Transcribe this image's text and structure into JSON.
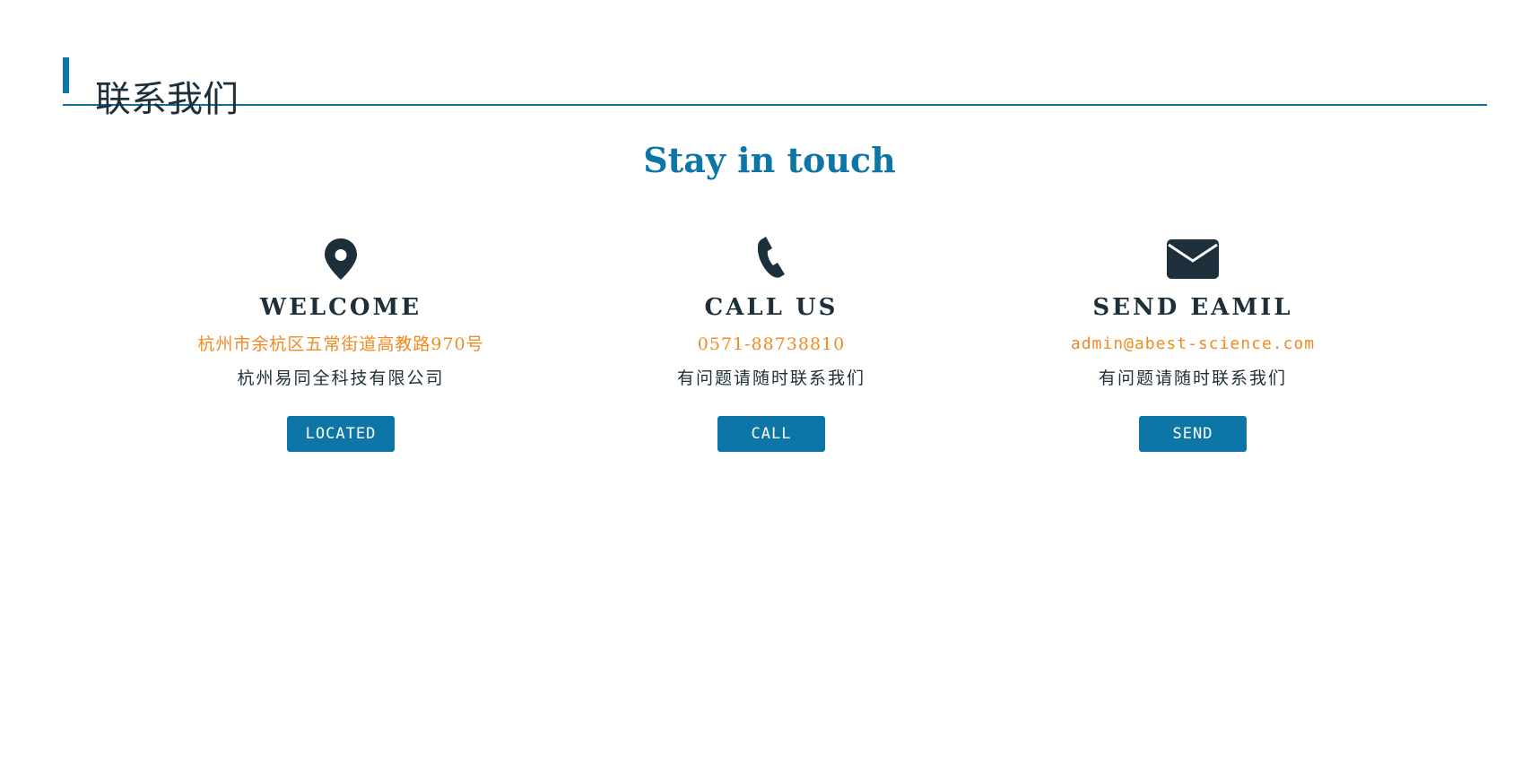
{
  "section": {
    "title": "联系我们"
  },
  "tagline": "Stay in touch",
  "cards": [
    {
      "icon": "map-pin-icon",
      "heading": "WELCOME",
      "highlight": "杭州市余杭区五常街道高教路970号",
      "description": "杭州易同全科技有限公司",
      "button_label": "LOCATED"
    },
    {
      "icon": "phone-icon",
      "heading": "CALL US",
      "highlight": "0571-88738810",
      "description": "有问题请随时联系我们",
      "button_label": "CALL"
    },
    {
      "icon": "envelope-icon",
      "heading": "SEND EAMIL",
      "highlight": "admin@abest-science.com",
      "description": "有问题请随时联系我们",
      "button_label": "SEND"
    }
  ],
  "colors": {
    "accent": "#0e76a6",
    "highlight": "#f08a22",
    "text": "#1d2f3a",
    "background": "#ffffff"
  }
}
